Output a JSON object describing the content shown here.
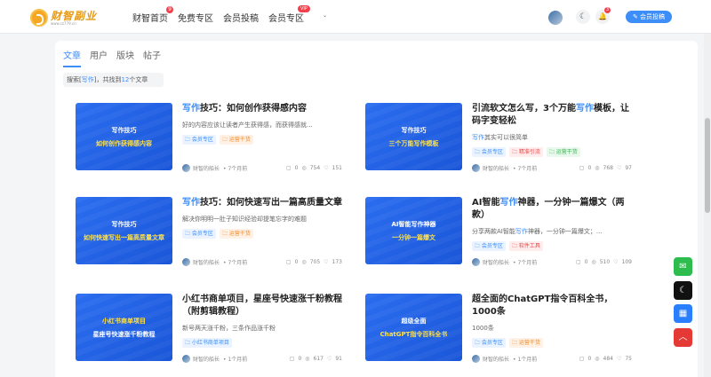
{
  "brand": {
    "logo_title": "财智副业",
    "logo_sub": "www.cz779.cn"
  },
  "nav": [
    {
      "label": "财智首页",
      "badge": "9"
    },
    {
      "label": "免费专区"
    },
    {
      "label": "会员投稿"
    },
    {
      "label": "会员专区",
      "badge": "VIP"
    }
  ],
  "header": {
    "notification_count": "3",
    "post_button": "会员投稿"
  },
  "tabs": [
    "文章",
    "用户",
    "版块",
    "帖子"
  ],
  "search_info": {
    "prefix": "搜索[",
    "keyword": "写作",
    "middle": "]，共找到",
    "count": "12",
    "suffix": "个文章"
  },
  "articles": [
    {
      "thumb_line1": "写作技巧",
      "thumb_line2": "如何创作获得感内容",
      "title_hl": "写作",
      "title_rest": "技巧：如何创作获得感内容",
      "desc": "好的内容应该让读者产生获得感，而获得感就...",
      "tags": [
        "会员专区",
        "运营干货"
      ],
      "author": "财智的船长",
      "time": "7个月前",
      "comments": "0",
      "views": "754",
      "likes": "151"
    },
    {
      "thumb_line1": "写作技巧",
      "thumb_line2": "三个万能写作模板",
      "title_pre": "引流软文怎么写，3个万能",
      "title_hl": "写作",
      "title_rest": "模板，让码字变轻松",
      "desc_hl": "写作",
      "desc": "其实可以很简单",
      "tags": [
        "会员专区",
        "精准引流",
        "运营干货"
      ],
      "author": "财智的船长",
      "time": "7个月前",
      "comments": "0",
      "views": "768",
      "likes": "97"
    },
    {
      "thumb_line1": "写作技巧",
      "thumb_line2": "如何快速写出一篇高质量文章",
      "title_hl": "写作",
      "title_rest": "技巧：如何快速写出一篇高质量文章",
      "desc": "解决你明明一肚子知识经验却提笔忘字的难题",
      "tags": [
        "会员专区",
        "运营干货"
      ],
      "author": "财智的船长",
      "time": "7个月前",
      "comments": "0",
      "views": "705",
      "likes": "173"
    },
    {
      "thumb_line1": "AI智能写作神器",
      "thumb_line2": "一分钟一篇爆文",
      "title_pre": "AI智能",
      "title_hl": "写作",
      "title_rest": "神器，一分钟一篇爆文（两款）",
      "desc_pre": "分享两款AI智能",
      "desc_hl": "写作",
      "desc": "神器，一分钟一篇爆文；...",
      "tags": [
        "会员专区",
        "软件工具"
      ],
      "author": "财智的船长",
      "time": "7个月前",
      "comments": "0",
      "views": "510",
      "likes": "109"
    },
    {
      "thumb_line1": "小红书商单项目",
      "thumb_line2": "星座号快速涨千粉教程",
      "title_rest": "小红书商单项目，星座号快速涨千粉教程（附剪辑教程）",
      "desc": "新号两天涨千粉，三条作品涨千粉",
      "tags": [
        "小红书商单项目"
      ],
      "author": "财智的船长",
      "time": "1个月前",
      "comments": "0",
      "views": "617",
      "likes": "91"
    },
    {
      "thumb_line1": "超级全面",
      "thumb_line2": "ChatGPT指令百科全书",
      "title_rest": "超全面的ChatGPT指令百科全书，1000条",
      "desc": "1000条",
      "tags": [
        "会员专区",
        "运营干货"
      ],
      "author": "财智的船长",
      "time": "1个月前",
      "comments": "0",
      "views": "484",
      "likes": "75"
    }
  ],
  "colors": {
    "accent": "#3d8ef8",
    "thumb_bg": "#2166ee",
    "thumb_highlight": "#ffe14a"
  }
}
